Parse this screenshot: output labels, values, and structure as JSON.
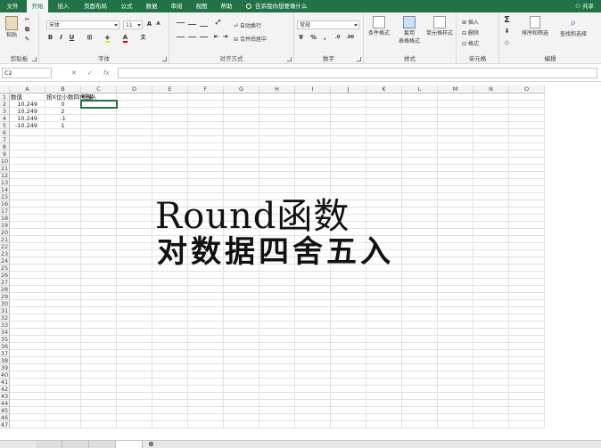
{
  "tabs": [
    "文件",
    "开始",
    "插入",
    "页面布局",
    "公式",
    "数据",
    "审阅",
    "视图",
    "帮助"
  ],
  "tell_me": "告诉我你想要做什么",
  "share": "共享",
  "ribbon": {
    "clipboard": {
      "label": "剪贴板",
      "paste": "粘贴"
    },
    "font": {
      "label": "字体",
      "name": "宋体",
      "size": "11",
      "bold": "B",
      "italic": "I",
      "underline": "U"
    },
    "alignment": {
      "label": "对齐方式",
      "wrap": "自动换行",
      "merge": "合并后居中"
    },
    "number": {
      "label": "数字",
      "format": "常规"
    },
    "styles": {
      "label": "样式",
      "conditional": "条件格式",
      "table_1": "套用",
      "table_2": "表格格式",
      "cell_styles": "单元格样式"
    },
    "cells": {
      "label": "单元格",
      "insert": "插入",
      "delete": "删除",
      "format": "格式"
    },
    "editing": {
      "label": "编辑",
      "sort": "排序和筛选",
      "find": "查找和选择"
    }
  },
  "formula_bar": {
    "name_box": "C2",
    "cancel": "✕",
    "confirm": "✓",
    "fx": "fx"
  },
  "sheet": {
    "columns": [
      "A",
      "B",
      "C",
      "D",
      "E",
      "F",
      "G",
      "H",
      "I",
      "J",
      "K",
      "L",
      "M",
      "N",
      "O"
    ],
    "rows": [
      "1",
      "2",
      "3",
      "4",
      "5",
      "6",
      "7",
      "8",
      "9",
      "10",
      "11",
      "12",
      "13",
      "14",
      "15",
      "16",
      "17",
      "18",
      "19",
      "20",
      "21",
      "22",
      "23",
      "24",
      "25",
      "26",
      "27",
      "28",
      "29",
      "30",
      "31",
      "32",
      "33",
      "34",
      "35",
      "36",
      "37",
      "38",
      "39",
      "40",
      "41",
      "42",
      "43",
      "44",
      "45",
      "46",
      "47"
    ],
    "cells": {
      "A1": "数值",
      "B1": "按X位小数四舍五入",
      "C1": "结果",
      "A2": "10.249",
      "B2": "0",
      "A3": "10.249",
      "B3": "2",
      "A4": "10.249",
      "B4": "-1",
      "A5": "-10.249",
      "B5": "1"
    }
  },
  "caption": {
    "line1": "Round函数",
    "line2": "对数据四舍五入"
  }
}
